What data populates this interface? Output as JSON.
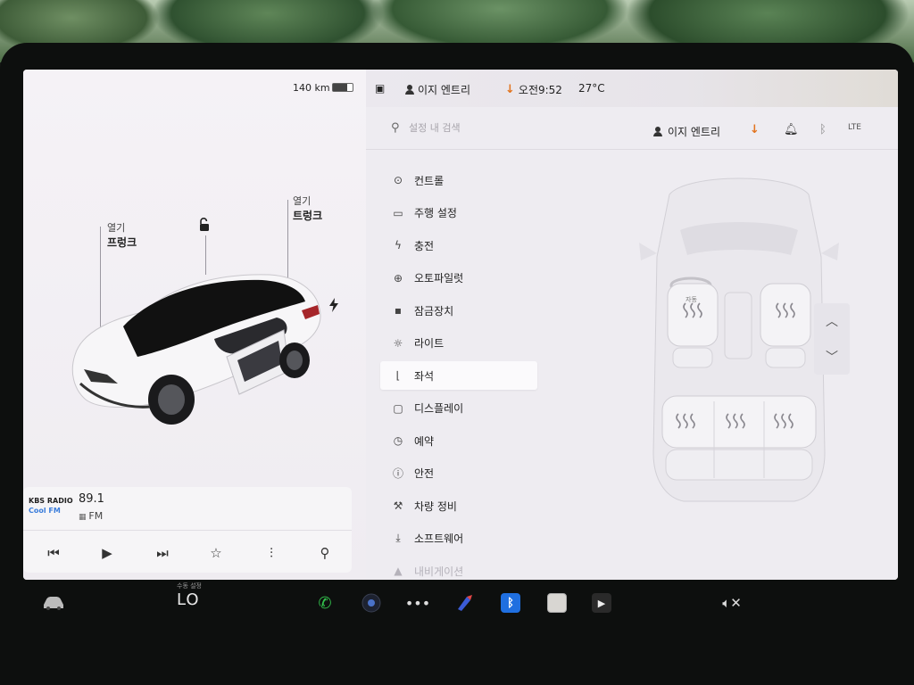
{
  "status_bar": {
    "range": "140 km",
    "battery_level": 0.72,
    "profile_name": "이지 엔트리",
    "time": "오전9:52",
    "temperature": "27°C"
  },
  "car_panel": {
    "frunk": {
      "state": "열기",
      "name": "프렁크"
    },
    "trunk": {
      "state": "열기",
      "name": "트렁크"
    },
    "lock_icon": "lock-open-icon",
    "charge_icon": "lightning-bolt-icon"
  },
  "media": {
    "station_line1": "KBS RADIO",
    "station_line2": "Cool FM",
    "frequency": "89.1",
    "band": "FM",
    "controls": [
      "previous-track-icon",
      "play-icon",
      "next-track-icon",
      "favorite-star-icon",
      "equalizer-icon",
      "search-icon"
    ]
  },
  "settings": {
    "search_placeholder": "설정 내 검색",
    "profile_name": "이지 엔트리",
    "header_icons": [
      "download-icon",
      "bell-icon",
      "bluetooth-icon",
      "lte-signal-icon"
    ],
    "lte_label": "LTE",
    "menu": [
      {
        "label": "컨트롤",
        "icon": "toggle-icon",
        "glyph": "⊙"
      },
      {
        "label": "주행 설정",
        "icon": "car-icon",
        "glyph": "▭"
      },
      {
        "label": "충전",
        "icon": "lightning-icon",
        "glyph": "ϟ"
      },
      {
        "label": "오토파일럿",
        "icon": "steering-wheel-icon",
        "glyph": "⊕"
      },
      {
        "label": "잠금장치",
        "icon": "lock-icon",
        "glyph": "▪"
      },
      {
        "label": "라이트",
        "icon": "sun-icon",
        "glyph": "☼"
      },
      {
        "label": "좌석",
        "icon": "seat-icon",
        "glyph": "⌊"
      },
      {
        "label": "디스플레이",
        "icon": "display-icon",
        "glyph": "▢"
      },
      {
        "label": "예약",
        "icon": "alarm-clock-icon",
        "glyph": "◷"
      },
      {
        "label": "안전",
        "icon": "info-circle-icon",
        "glyph": "ⓘ"
      },
      {
        "label": "차량 정비",
        "icon": "wrench-icon",
        "glyph": "⚒"
      },
      {
        "label": "소프트웨어",
        "icon": "download-icon",
        "glyph": "⤓"
      },
      {
        "label": "내비게이션",
        "icon": "navigation-icon",
        "glyph": "▲"
      }
    ],
    "active_index": 6,
    "seat_heater_labels": {
      "driver_tag": "자동"
    }
  },
  "dock": {
    "temperature_caption": "수동 설정",
    "temperature_value": "LO",
    "items": [
      "car-icon",
      "phone-icon",
      "camera-icon",
      "more-icon",
      "toybox-icon",
      "bluetooth-icon",
      "notepad-icon",
      "video-icon",
      "volume-muted-icon"
    ]
  },
  "colors": {
    "accent_orange": "#e2741f",
    "phone_green": "#33c24d",
    "bluetooth_blue": "#1f6fe0"
  }
}
